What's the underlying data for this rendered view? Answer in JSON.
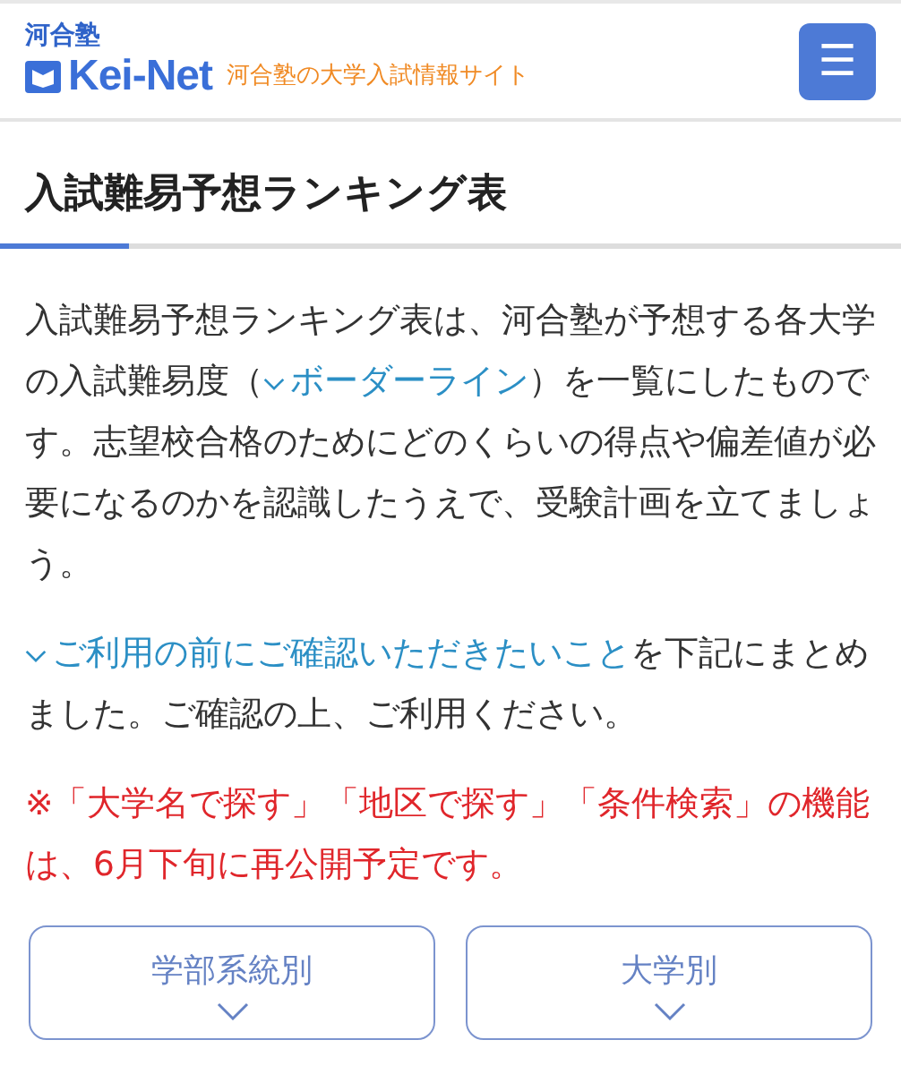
{
  "header": {
    "brand_small": "河合塾",
    "brand": "Kei-Net",
    "tagline": "河合塾の大学入試情報サイト",
    "menu_button": "☰"
  },
  "title": "入試難易予想ランキング表",
  "paragraphs": [
    {
      "before": "入試難易予想ランキング表は、河合塾が予想する各大学の入試難易度（",
      "link": "ボーダーライン",
      "after": "）を一覧にしたものです。志望校合格のためにどのくらいの得点や偏差値が必要になるのかを認識したうえで、受験計画を立てましょう。"
    },
    {
      "link": "ご利用の前にご確認いただきたいこと",
      "after": "を下記にまとめました。ご確認の上、ご利用ください。"
    }
  ],
  "notice": "※「大学名で探す」「地区で探す」「条件検索」の機能は、6月下旬に再公開予定です。",
  "buttons": [
    {
      "label": "学部系統別",
      "expanded": false
    },
    {
      "label": "大学別",
      "expanded": false
    }
  ]
}
